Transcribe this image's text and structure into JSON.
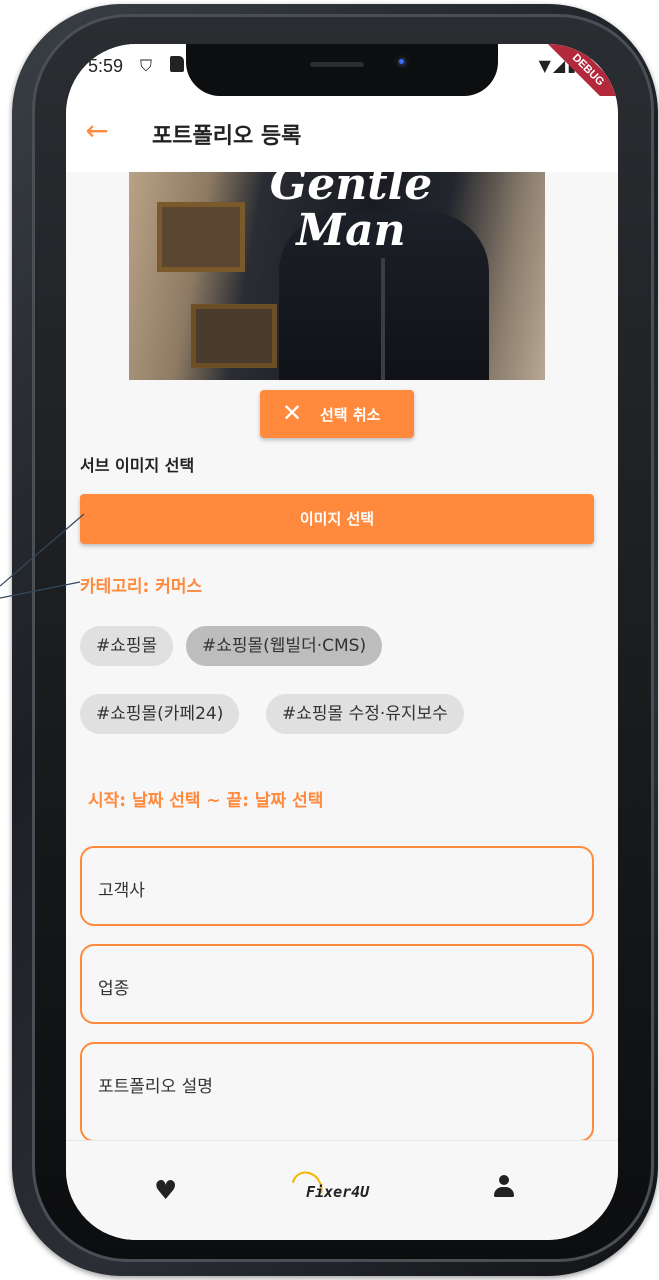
{
  "status_bar": {
    "time": "5:59",
    "debug_label": "DEBUG",
    "dnd_icon": "shield-icon",
    "sd_icon": "sd-card-icon",
    "system_icons": "▼◢▮"
  },
  "app_bar": {
    "back_icon": "arrow-left-icon",
    "back_glyph": "←",
    "title": "포트폴리오 등록"
  },
  "hero_image": {
    "brand_text_line1": "Gentle",
    "brand_text_line2": "Man"
  },
  "cancel_button": {
    "icon": "close-icon",
    "icon_glyph": "✕",
    "label": "선택 취소"
  },
  "sub_image": {
    "label": "서브 이미지 선택",
    "button_label": "이미지 선택"
  },
  "category": {
    "label": "카테고리: 커머스",
    "chips": [
      {
        "label": "#쇼핑몰",
        "selected": false
      },
      {
        "label": "#쇼핑몰(웹빌더·CMS)",
        "selected": true
      },
      {
        "label": "#쇼핑몰(카페24)",
        "selected": false
      },
      {
        "label": "#쇼핑몰 수정·유지보수",
        "selected": false
      }
    ]
  },
  "dates": {
    "text": "시작: 날짜 선택  ~  끝: 날짜 선택"
  },
  "fields": {
    "client": "고객사",
    "industry": "업종",
    "description": "포트폴리오 설명"
  },
  "bottom_nav": {
    "favorites_icon": "heart-icon",
    "favorites_glyph": "♥",
    "logo_text": "Fixer4U",
    "profile_icon": "person-icon"
  },
  "colors": {
    "accent": "#ff8a3d",
    "chip_bg": "#e0e0e0",
    "chip_selected_bg": "#bdbdbd"
  }
}
